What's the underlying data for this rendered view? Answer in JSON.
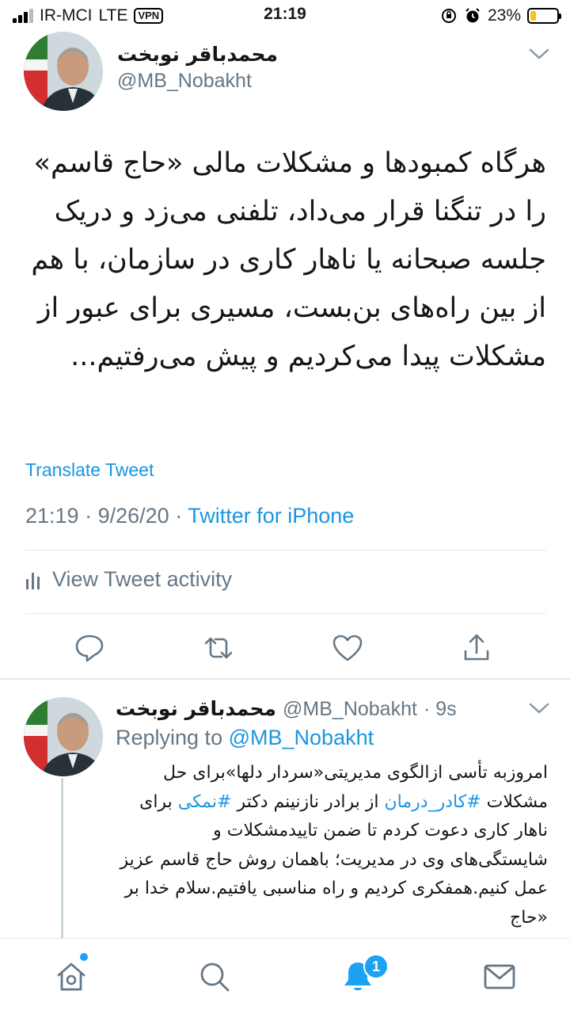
{
  "status_bar": {
    "carrier": "IR-MCI",
    "network": "LTE",
    "vpn": "VPN",
    "time": "21:19",
    "battery_percent": "23%",
    "battery_level": 0.23,
    "battery_color": "#f5c518"
  },
  "main_tweet": {
    "name": "محمدباقر نوبخت",
    "handle": "@MB_Nobakht",
    "text": "هرگاه کمبودها و مشکلات مالی «حاج قاسم» را در تنگنا قرار می‌داد، تلفنی می‌زد و دریک جلسه صبحانه یا ناهار کاری در سازمان، با هم از بین راه‌های بن‌بست، مسیری برای عبور از مشکلات پیدا می‌کردیم و پیش می‌رفتیم...",
    "translate_label": "Translate Tweet",
    "time": "21:19",
    "date": "9/26/20",
    "separator": "·",
    "source": "Twitter for iPhone",
    "activity_label": "View Tweet activity"
  },
  "actions": [
    "reply-icon",
    "retweet-icon",
    "like-icon",
    "share-icon"
  ],
  "reply_tweet": {
    "name": "محمدباقر نوبخت",
    "handle": "@MB_Nobakht",
    "age": "· 9s",
    "replying_prefix": "Replying to",
    "replying_handle": "@MB_Nobakht",
    "text_part1": "امروزبه تأسی ازالگوی مدیریتی«سردار دلها»برای حل مشکلات ",
    "hashtag1": "#کادر_درمان",
    "text_part2": " از برادر نازنینم دکتر ",
    "hashtag2": "#نمکی",
    "text_part3": " برای ناهار کاری دعوت کردم تا ضمن تاییدمشکلات و شایستگی‌های وی در مدیریت؛ باهمان روش حاج قاسم عزیز عمل کنیم.همفکری کردیم و راه مناسبی یافتیم.سلام خدا بر «حاج"
  },
  "tab_bar": {
    "tabs": [
      "home-icon",
      "search-icon",
      "notifications-icon",
      "messages-icon"
    ],
    "notification_count": "1"
  },
  "colors": {
    "accent": "#1da1f2",
    "link": "#1b95e0",
    "secondary_text": "#657786",
    "divider": "#e1e8ed"
  }
}
